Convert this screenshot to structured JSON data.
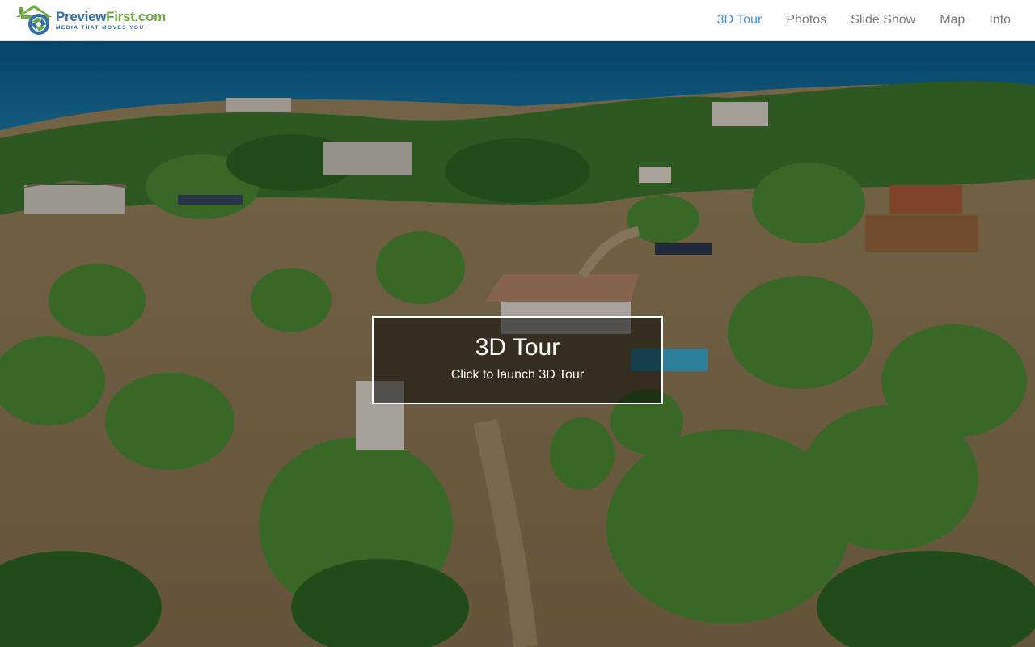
{
  "brand": {
    "name_part_a": "Preview",
    "name_part_b": "First.com",
    "tagline": "MEDIA THAT MOVES YOU",
    "icon": "house-camera-shutter-icon"
  },
  "nav": {
    "items": [
      {
        "label": "3D Tour",
        "active": true
      },
      {
        "label": "Photos",
        "active": false
      },
      {
        "label": "Slide Show",
        "active": false
      },
      {
        "label": "Map",
        "active": false
      },
      {
        "label": "Info",
        "active": false
      }
    ],
    "active_color": "#4a90d9",
    "inactive_color": "#7a7a7a"
  },
  "hero": {
    "image": "aerial-property-photo",
    "overlay": {
      "title": "3D Tour",
      "subtitle": "Click to launch 3D Tour"
    }
  }
}
